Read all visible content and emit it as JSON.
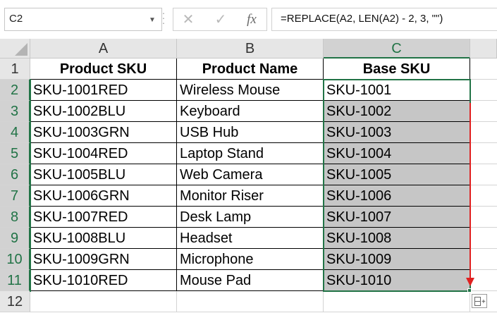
{
  "formula_bar": {
    "name_box": "C2",
    "formula": "=REPLACE(A2, LEN(A2) - 2, 3, \"\")",
    "cancel_glyph": "✕",
    "enter_glyph": "✓",
    "fx_glyph": "fx"
  },
  "columns": [
    "A",
    "B",
    "C"
  ],
  "rows": [
    "1",
    "2",
    "3",
    "4",
    "5",
    "6",
    "7",
    "8",
    "9",
    "10",
    "11",
    "12"
  ],
  "headers": [
    "Product SKU",
    "Product Name",
    "Base SKU"
  ],
  "data": [
    [
      "SKU-1001RED",
      "Wireless Mouse",
      "SKU-1001"
    ],
    [
      "SKU-1002BLU",
      "Keyboard",
      "SKU-1002"
    ],
    [
      "SKU-1003GRN",
      "USB Hub",
      "SKU-1003"
    ],
    [
      "SKU-1004RED",
      "Laptop Stand",
      "SKU-1004"
    ],
    [
      "SKU-1005BLU",
      "Web Camera",
      "SKU-1005"
    ],
    [
      "SKU-1006GRN",
      "Monitor Riser",
      "SKU-1006"
    ],
    [
      "SKU-1007RED",
      "Desk Lamp",
      "SKU-1007"
    ],
    [
      "SKU-1008BLU",
      "Headset",
      "SKU-1008"
    ],
    [
      "SKU-1009GRN",
      "Microphone",
      "SKU-1009"
    ],
    [
      "SKU-1010RED",
      "Mouse Pad",
      "SKU-1010"
    ]
  ],
  "colors": {
    "accent": "#217346",
    "arrow": "#e02020",
    "selection_fill": "#c6c6c6"
  },
  "icons": [
    "dropdown-arrow-icon",
    "cancel-icon",
    "enter-check-icon",
    "function-fx-icon",
    "select-all-triangle-icon",
    "autofill-options-icon",
    "fill-down-arrow-icon"
  ]
}
